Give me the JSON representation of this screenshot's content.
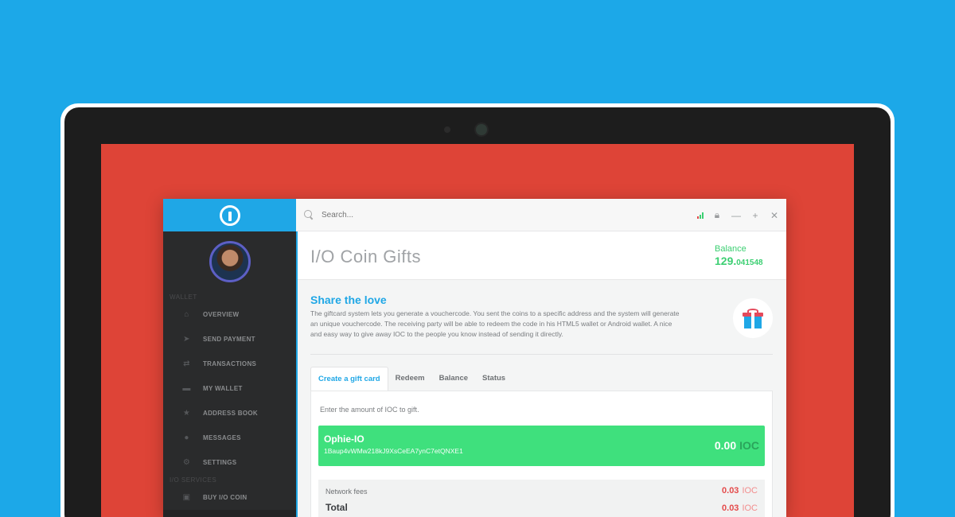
{
  "app": {
    "search_placeholder": "Search..."
  },
  "sidebar": {
    "sections": {
      "wallet": "WALLET",
      "services": "I/O SERVICES"
    },
    "items": [
      {
        "label": "OVERVIEW",
        "icon": "home-icon"
      },
      {
        "label": "SEND PAYMENT",
        "icon": "send-icon"
      },
      {
        "label": "TRANSACTIONS",
        "icon": "transfer-icon"
      },
      {
        "label": "MY WALLET",
        "icon": "wallet-icon"
      },
      {
        "label": "ADDRESS BOOK",
        "icon": "star-icon"
      },
      {
        "label": "MESSAGES",
        "icon": "chat-icon"
      },
      {
        "label": "SETTINGS",
        "icon": "gears-icon"
      }
    ],
    "service_items": [
      {
        "label": "BUY I/O COIN",
        "icon": "cart-icon"
      }
    ]
  },
  "header": {
    "title": "I/O Coin Gifts",
    "balance_label": "Balance",
    "balance_int": "129.",
    "balance_dec": "041548"
  },
  "intro": {
    "title": "Share the love",
    "text": "The giftcard system lets you generate a vouchercode. You sent the coins to a specific address and the system will generate an unique vouchercode. The receiving party will be able to redeem the code in his HTML5 wallet or Android wallet. A nice and easy way to give away IOC to the people you know instead of sending it directly."
  },
  "tabs": [
    "Create a gift card",
    "Redeem",
    "Balance",
    "Status"
  ],
  "form": {
    "hint": "Enter the amount of IOC to gift.",
    "wallet_name": "Ophie-IO",
    "wallet_address": "1Baup4vWMw218kJ9XsCeEA7ynC7etQNXE1",
    "amount": "0.00",
    "unit": "IOC"
  },
  "fees": {
    "network_label": "Network fees",
    "network_value": "0.03",
    "total_label": "Total",
    "total_value": "0.03",
    "unit": "IOC"
  },
  "colors": {
    "background": "#1ca8e8",
    "screen": "#de4437",
    "accent": "#1fa7e6",
    "positive": "#3fe07d",
    "negative": "#e44a4a"
  }
}
